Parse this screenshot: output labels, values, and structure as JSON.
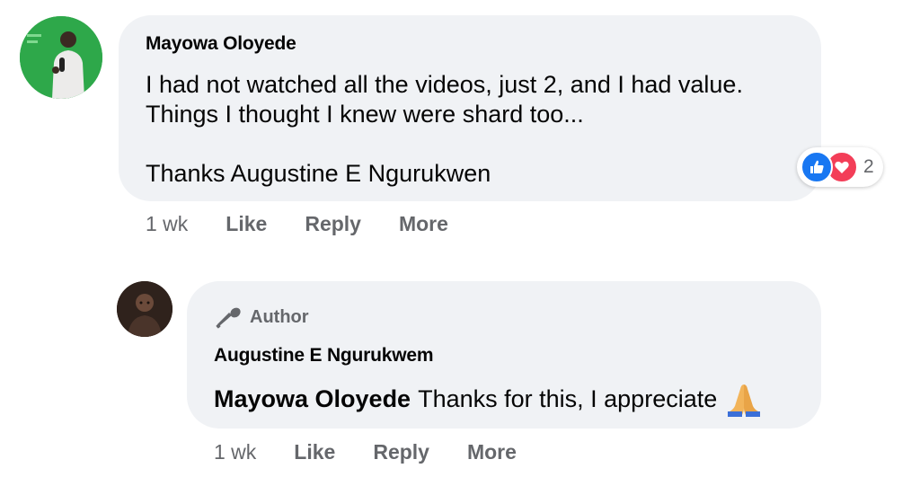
{
  "comment": {
    "author": "Mayowa Oloyede",
    "text": "I had not watched all the videos, just 2, and I had value.\nThings I thought I knew were shard too...\n\nThanks Augustine E Ngurukwen",
    "reactions": {
      "icons": [
        "like-icon",
        "love-icon"
      ],
      "count": "2"
    },
    "actions": {
      "time": "1 wk",
      "like": "Like",
      "reply": "Reply",
      "more": "More"
    }
  },
  "reply": {
    "badge": "Author",
    "author": "Augustine E Ngurukwem",
    "mention": "Mayowa Oloyede",
    "text": "Thanks for this, I appreciate",
    "emoji": "folded-hands-emoji",
    "actions": {
      "time": "1 wk",
      "like": "Like",
      "reply": "Reply",
      "more": "More"
    }
  },
  "colors": {
    "bubble": "#f0f2f5",
    "secondary_text": "#65676b",
    "like_blue": "#1877f2",
    "love_red": "#f33e58"
  }
}
